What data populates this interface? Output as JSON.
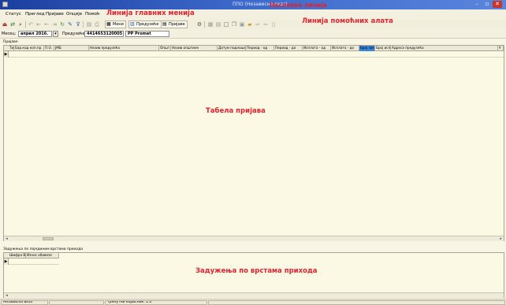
{
  "window": {
    "title": "ППО (Независна веза)",
    "minimize": "–",
    "maximize": "▫",
    "close": "✕"
  },
  "annotations": {
    "title_line": "Насловна линија",
    "main_menu_line": "Линија главних менија",
    "toolbar_line": "Линија помоћних алата",
    "applications_table": "Табела пријава",
    "revenue_debts": "Задужења по врстама прихода"
  },
  "menu": {
    "items": [
      "Статус",
      "Преглед",
      "Пријаве",
      "Опције",
      "Помоћ"
    ]
  },
  "toolbar": {
    "meni_label": "Мени",
    "preduzece_label": "Предузеће",
    "prijave_label": "Пријаве"
  },
  "filters": {
    "period_label": "Месец:",
    "period_value": "април 2016.",
    "dropdown": "▾",
    "company_label": "Предузеће:",
    "company_id": "4414653120005",
    "company_name": "PP Promet"
  },
  "applications": {
    "group_label": "Пријаве",
    "columns": [
      "Тип",
      "Бар.код коп.пр.",
      "П.О.",
      "ЈМБ",
      "Назив предузећа",
      "Општ",
      "Назив општине",
      "Датум подношења",
      "Период - од",
      "Период - до",
      "Исплата - од",
      "Исплата - до",
      "Број зап.",
      "Број испл.",
      "Адреса предузећа",
      "У"
    ],
    "row_indicator": "▶"
  },
  "debts": {
    "group_label": "Задужења по појединим врстама прихода",
    "columns": [
      "Шифра ВП",
      "Износ обавезе"
    ],
    "row_indicator": "▶"
  },
  "scroll": {
    "left": "◂",
    "right": "▸"
  },
  "status": {
    "panels": [
      "Независна веза",
      "",
      "Тренутни корисник: 1.0",
      ""
    ]
  }
}
